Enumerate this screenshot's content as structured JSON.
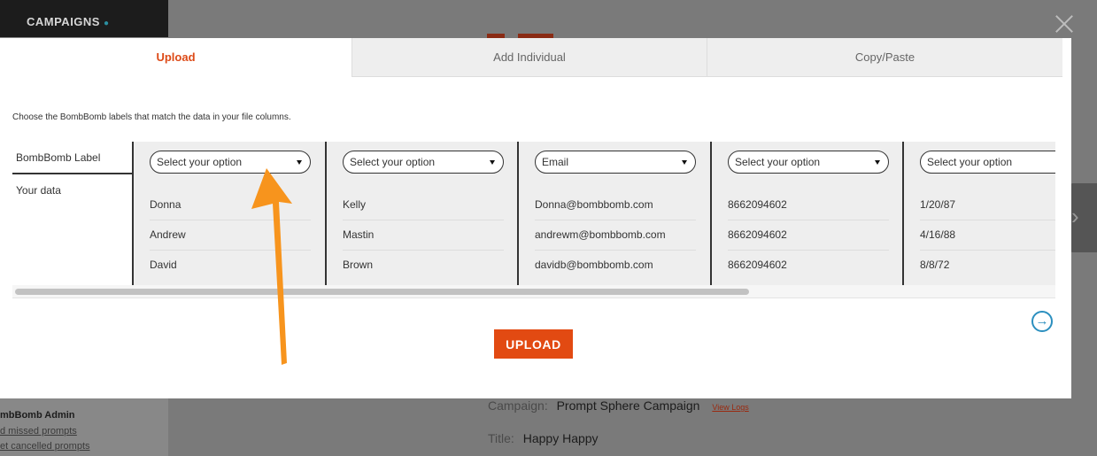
{
  "background": {
    "sidebar_heading": "CAMPAIGNS",
    "admin_heading": "mbBomb Admin",
    "links": [
      "d missed prompts",
      "et cancelled prompts"
    ],
    "campaign_key": "Campaign:",
    "campaign_value": "Prompt Sphere Campaign",
    "view_logs": "View Logs",
    "title_key": "Title:",
    "title_value": "Happy Happy"
  },
  "modal": {
    "tabs": [
      {
        "label": "Upload",
        "active": true
      },
      {
        "label": "Add Individual",
        "active": false
      },
      {
        "label": "Copy/Paste",
        "active": false
      }
    ],
    "instruction": "Choose the BombBomb labels that match the data in your file columns.",
    "row_labels": {
      "label": "BombBomb Label",
      "data": "Your data"
    },
    "columns": [
      {
        "select": "Select your option",
        "values": [
          "Donna",
          "Andrew",
          "David"
        ]
      },
      {
        "select": "Select your option",
        "values": [
          "Kelly",
          "Mastin",
          "Brown"
        ]
      },
      {
        "select": "Email",
        "values": [
          "Donna@bombbomb.com",
          "andrewm@bombbomb.com",
          "davidb@bombbomb.com"
        ]
      },
      {
        "select": "Select your option",
        "values": [
          "8662094602",
          "8662094602",
          "8662094602"
        ]
      },
      {
        "select": "Select your option",
        "values": [
          "1/20/87",
          "4/16/88",
          "8/8/72"
        ]
      }
    ],
    "upload_button": "UPLOAD",
    "icons": {
      "next": "arrow-right-circle-icon",
      "close": "close-icon",
      "annotation": "orange-arrow"
    }
  },
  "colors": {
    "accent": "#e24a12",
    "link_blue": "#2b8fbf",
    "annotation": "#f7941d"
  }
}
